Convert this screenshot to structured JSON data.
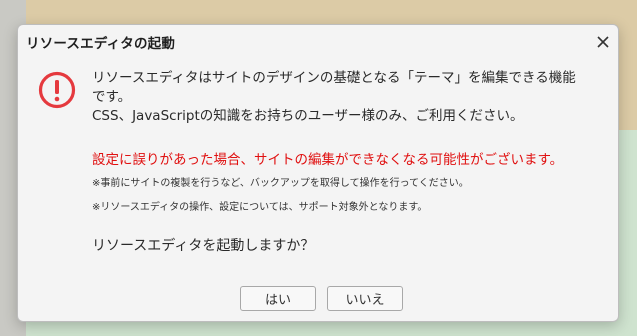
{
  "dialog": {
    "title": "リソースエディタの起動",
    "close_icon": "close-icon",
    "warning_icon": "exclamation-circle-icon",
    "message_line1": "リソースエディタはサイトのデザインの基礎となる「テーマ」を編集できる機能",
    "message_line2": "です。",
    "message_line3": "CSS、JavaScriptの知識をお持ちのユーザー様のみ、ご利用ください。",
    "warning": "設定に誤りがあった場合、サイトの編集ができなくなる可能性がございます。",
    "note1": "※事前にサイトの複製を行うなど、バックアップを取得して操作を行ってください。",
    "note2": "※リソースエディタの操作、設定については、サポート対象外となります。",
    "question": "リソースエディタを起動しますか？",
    "buttons": {
      "yes": "はい",
      "no": "いいえ"
    }
  },
  "colors": {
    "warning_red": "#e01010",
    "icon_red": "#e5393e"
  }
}
